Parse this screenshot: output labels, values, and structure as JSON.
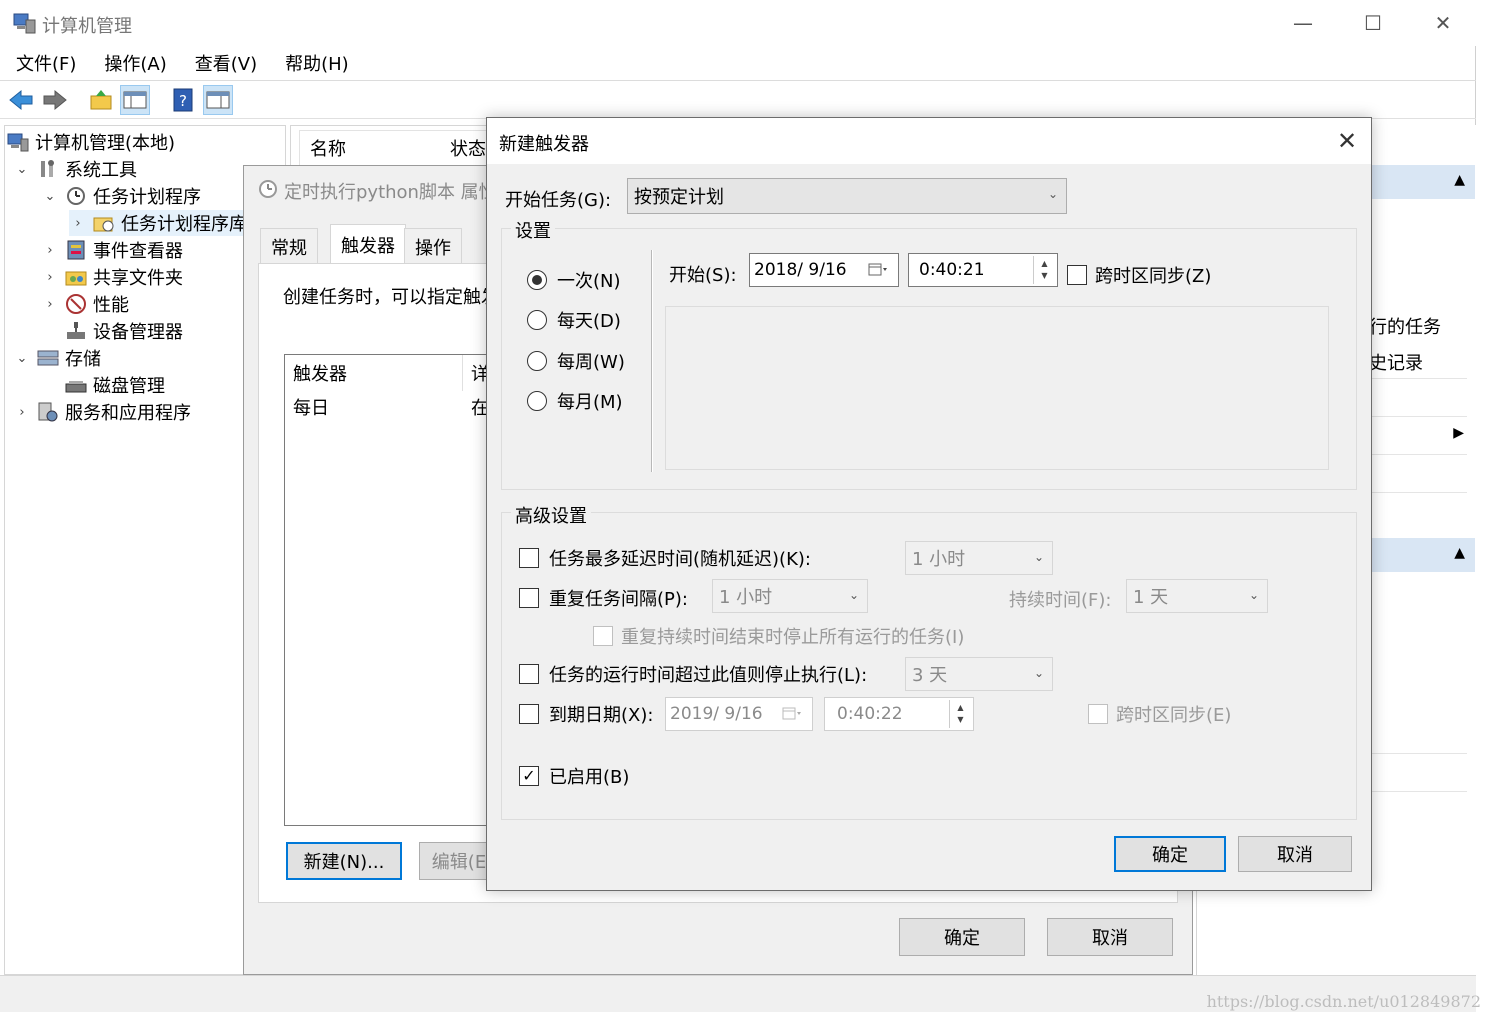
{
  "main_window": {
    "title": "计算机管理",
    "min_symbol": "—",
    "max_symbol": "☐",
    "close_symbol": "✕",
    "menu": [
      "文件(F)",
      "操作(A)",
      "查看(V)",
      "帮助(H)"
    ],
    "toolbar_icons": [
      "back-arrow-icon",
      "forward-arrow-icon",
      "up-folder-icon",
      "console-tree-icon",
      "help-icon",
      "action-pane-icon"
    ]
  },
  "tree": {
    "items": [
      {
        "label": "计算机管理(本地)",
        "chevron": ""
      },
      {
        "label": "系统工具",
        "chevron": "⌄"
      },
      {
        "label": "任务计划程序",
        "chevron": "⌄"
      },
      {
        "label": "任务计划程序库",
        "chevron": "›"
      },
      {
        "label": "事件查看器",
        "chevron": "›"
      },
      {
        "label": "共享文件夹",
        "chevron": "›"
      },
      {
        "label": "性能",
        "chevron": "›"
      },
      {
        "label": "设备管理器",
        "chevron": ""
      },
      {
        "label": "存储",
        "chevron": "⌄"
      },
      {
        "label": "磁盘管理",
        "chevron": ""
      },
      {
        "label": "服务和应用程序",
        "chevron": "›"
      }
    ]
  },
  "list_header": {
    "name": "名称",
    "status": "状态"
  },
  "right_pane": {
    "item1": "行的任务",
    "item2": "史记录",
    "collapse_arrow": "▲",
    "expand_arrow": "▶"
  },
  "properties_dialog": {
    "title": "定时执行python脚本 属性",
    "tabs": [
      "常规",
      "触发器",
      "操作"
    ],
    "description": "创建任务时，可以指定触发",
    "table_headers": [
      "触发器",
      "详"
    ],
    "rows": [
      {
        "trigger": "每日",
        "detail": "在"
      }
    ],
    "new_button": "新建(N)...",
    "edit_button": "编辑(E",
    "ok_button": "确定",
    "cancel_button": "取消"
  },
  "new_trigger_dialog": {
    "title": "新建触发器",
    "close_symbol": "✕",
    "begin_task_label": "开始任务(G):",
    "begin_task_value": "按预定计划",
    "settings_label": "设置",
    "schedule_options": [
      "一次(N)",
      "每天(D)",
      "每周(W)",
      "每月(M)"
    ],
    "selected_schedule": "一次(N)",
    "start_label": "开始(S):",
    "start_date": "2018/  9/16",
    "start_time": "0:40:21",
    "sync_timezone_label": "跨时区同步(Z)",
    "advanced_label": "高级设置",
    "delay": {
      "label": "任务最多延迟时间(随机延迟)(K):",
      "value": "1 小时",
      "checked": false
    },
    "repeat": {
      "label": "重复任务间隔(P):",
      "value": "1 小时",
      "duration_label": "持续时间(F):",
      "duration_value": "1 天",
      "checked": false
    },
    "stop_all_label": "重复持续时间结束时停止所有运行的任务(I)",
    "stop_longer": {
      "label": "任务的运行时间超过此值则停止执行(L):",
      "value": "3 天",
      "checked": false
    },
    "expire": {
      "label": "到期日期(X):",
      "date": "2019/  9/16",
      "time": "0:40:22",
      "sync_label": "跨时区同步(E)",
      "checked": false
    },
    "enabled": {
      "label": "已启用(B)",
      "checked": true,
      "check_mark": "✓"
    },
    "ok_button": "确定",
    "cancel_button": "取消"
  },
  "watermark": "https://blog.csdn.net/u012849872"
}
